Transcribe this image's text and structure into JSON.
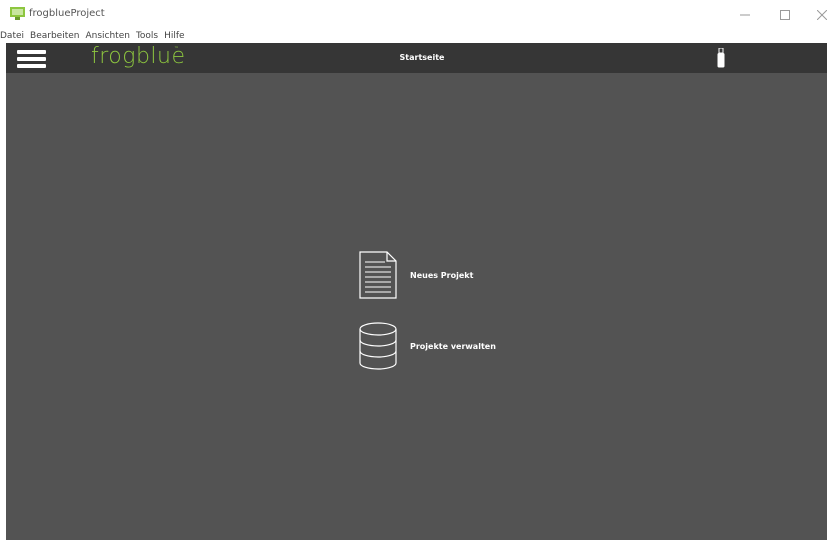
{
  "window": {
    "title": "frogblueProject",
    "minimize_glyph": "—",
    "maximize_glyph": "☐",
    "close_glyph": "✕"
  },
  "menu": {
    "items": [
      {
        "label": "Datei"
      },
      {
        "label": "Bearbeiten"
      },
      {
        "label": "Ansichten"
      },
      {
        "label": "Tools"
      },
      {
        "label": "Hilfe"
      }
    ]
  },
  "toolbar": {
    "logo_text": "frogblue",
    "logo_tm": "™",
    "page_title": "Startseite",
    "menu_icon": "hamburger-menu-icon",
    "device_icon": "usb-stick-icon"
  },
  "main": {
    "actions": [
      {
        "label": "Neues Projekt",
        "icon": "document-icon"
      },
      {
        "label": "Projekte verwalten",
        "icon": "database-icon"
      }
    ]
  },
  "colors": {
    "brand_green": "#8dc63f",
    "toolbar_bg": "#363636",
    "main_bg": "#535353",
    "text_on_dark": "#ffffff"
  }
}
